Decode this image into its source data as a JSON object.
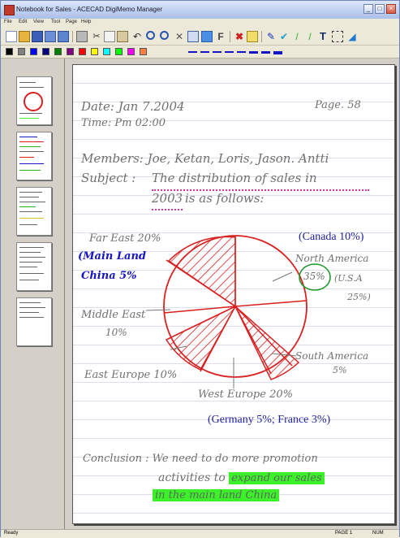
{
  "app": {
    "title": "Notebook for Sales - ACECAD DigiMemo Manager"
  },
  "window_controls": {
    "minimize": "_",
    "maximize": "□",
    "close": "×"
  },
  "menu": [
    {
      "label": "File"
    },
    {
      "label": "Edit"
    },
    {
      "label": "View"
    },
    {
      "label": "Tool"
    },
    {
      "label": "Page"
    },
    {
      "label": "Help"
    }
  ],
  "toolbar": {
    "icons": [
      "new-icon",
      "open-icon",
      "save-icon",
      "import-icon",
      "calendar-icon",
      "print-icon",
      "cut-icon",
      "copy-icon",
      "paste-icon",
      "undo-icon",
      "zoom-in-icon",
      "zoom-out-icon",
      "delete-icon",
      "select-icon",
      "image-icon",
      "font-icon",
      "close-doc-icon",
      "export-icon",
      "pen-icon",
      "highlighter-icon",
      "line-icon",
      "green-pen-icon",
      "text-tool-icon",
      "select-rect-icon",
      "eraser-icon"
    ],
    "text_tool_glyph": "T",
    "font_tool_glyph": "F"
  },
  "colors": {
    "palette": [
      "#000000",
      "#808080",
      "#0000ff",
      "#000080",
      "#008000",
      "#800080",
      "#ff0000",
      "#ffff00",
      "#00ffff",
      "#00ff00",
      "#ff00ff",
      "#ff8040"
    ],
    "accent": "#1515c8",
    "ink_red": "#d82020",
    "ink_blue": "#1616c4",
    "highlight": "#3cf02a"
  },
  "thumbnails": [
    {
      "name": "page-thumb-1",
      "active": false
    },
    {
      "name": "page-thumb-2",
      "active": false
    },
    {
      "name": "page-thumb-3",
      "active": false
    },
    {
      "name": "page-thumb-4",
      "active": false
    },
    {
      "name": "page-thumb-5",
      "active": false
    }
  ],
  "page": {
    "date": "Date: Jan 7.2004",
    "page_no": "Page. 58",
    "time": "Time: Pm 02:00",
    "members": "Members: Joe, Ketan, Loris, Jason. Antti",
    "subject_prefix": "Subject : ",
    "subject_line1": "The distribution of sales in",
    "subject_year": "2003",
    "subject_rest": " is as follows:",
    "far_east": "Far East 20%",
    "main_land_1": "(Main Land",
    "main_land_2": "China 5%",
    "middle_east_1": "Middle East",
    "middle_east_2": "10%",
    "east_europe": "East Europe 10%",
    "west_europe": "West Europe 20%",
    "canada": "(Canada 10%)",
    "north_america": "North America",
    "us_pct": "35%",
    "usa_1": "(U.S.A",
    "usa_2": "25%)",
    "south_america_1": "South America",
    "south_america_2": "5%",
    "germany_france": "(Germany 5%; France 3%)",
    "conclusion_1": "Conclusion : We need to do more promotion",
    "conclusion_2a": "activities to ",
    "conclusion_2b": "expand our sales",
    "conclusion_3": "in the main land China"
  },
  "status": {
    "left": "Ready",
    "page": "PAGE 1",
    "num": "NUM"
  }
}
